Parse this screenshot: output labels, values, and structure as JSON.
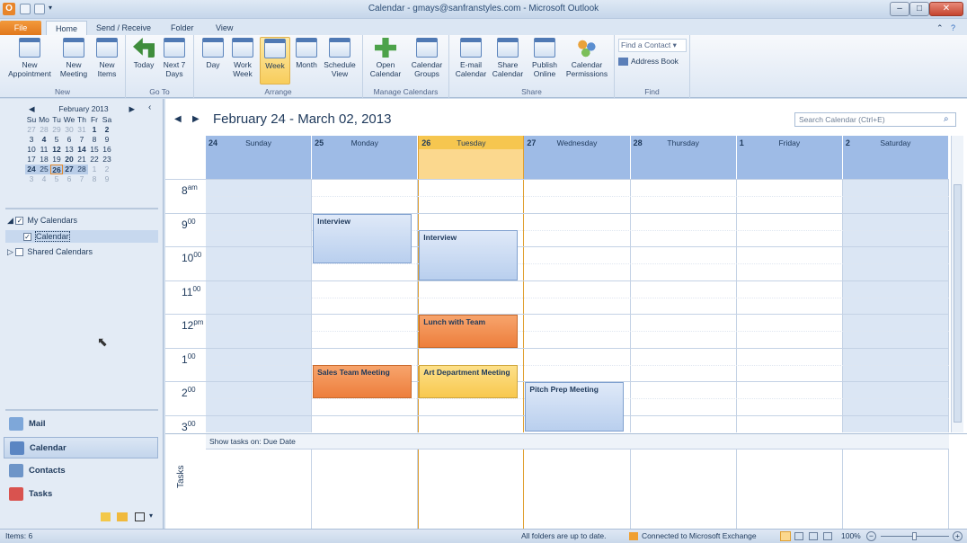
{
  "window": {
    "title": "Calendar - gmays@sanfranstyles.com - Microsoft Outlook",
    "app_letter": "O"
  },
  "tabs": [
    "File",
    "Home",
    "Send / Receive",
    "Folder",
    "View"
  ],
  "ribbon": {
    "groups": [
      "New",
      "Go To",
      "Arrange",
      "Manage Calendars",
      "Share",
      "Find"
    ],
    "buttons": {
      "new_appointment": "New Appointment",
      "new_meeting": "New Meeting",
      "new_items": "New Items",
      "today": "Today",
      "next7": "Next 7 Days",
      "day": "Day",
      "work_week": "Work Week",
      "week": "Week",
      "month": "Month",
      "schedule": "Schedule View",
      "open_calendar": "Open Calendar",
      "calendar_groups": "Calendar Groups",
      "email_calendar": "E-mail Calendar",
      "share_calendar": "Share Calendar",
      "publish_online": "Publish Online",
      "calendar_permissions": "Calendar Permissions",
      "find_contact": "Find a Contact",
      "address_book": "Address Book"
    }
  },
  "minical": {
    "title": "February 2013",
    "weekdays": [
      "Su",
      "Mo",
      "Tu",
      "We",
      "Th",
      "Fr",
      "Sa"
    ],
    "weeks": [
      [
        "27",
        "28",
        "29",
        "30",
        "31",
        "1",
        "2"
      ],
      [
        "3",
        "4",
        "5",
        "6",
        "7",
        "8",
        "9"
      ],
      [
        "10",
        "11",
        "12",
        "13",
        "14",
        "15",
        "16"
      ],
      [
        "17",
        "18",
        "19",
        "20",
        "21",
        "22",
        "23"
      ],
      [
        "24",
        "25",
        "26",
        "27",
        "28",
        "1",
        "2"
      ],
      [
        "3",
        "4",
        "5",
        "6",
        "7",
        "8",
        "9"
      ]
    ]
  },
  "nav": {
    "my_calendars": "My Calendars",
    "calendar": "Calendar",
    "shared_calendars": "Shared Calendars",
    "mail": "Mail",
    "calendar_btn": "Calendar",
    "contacts": "Contacts",
    "tasks": "Tasks"
  },
  "main": {
    "range_title": "February 24 - March 02, 2013",
    "search_placeholder": "Search Calendar (Ctrl+E)",
    "days": [
      {
        "num": "24",
        "name": "Sunday"
      },
      {
        "num": "25",
        "name": "Monday"
      },
      {
        "num": "26",
        "name": "Tuesday"
      },
      {
        "num": "27",
        "name": "Wednesday"
      },
      {
        "num": "28",
        "name": "Thursday"
      },
      {
        "num": "1",
        "name": "Friday"
      },
      {
        "num": "2",
        "name": "Saturday"
      }
    ],
    "times": [
      {
        "h": "8",
        "s": "am"
      },
      {
        "h": "9",
        "s": "00"
      },
      {
        "h": "10",
        "s": "00"
      },
      {
        "h": "11",
        "s": "00"
      },
      {
        "h": "12",
        "s": "pm"
      },
      {
        "h": "1",
        "s": "00"
      },
      {
        "h": "2",
        "s": "00"
      },
      {
        "h": "3",
        "s": "00"
      }
    ],
    "appointments": [
      {
        "title": "Interview",
        "day": 1,
        "start": 9.0,
        "end": 10.5,
        "color": "blue"
      },
      {
        "title": "Interview",
        "day": 2,
        "start": 9.5,
        "end": 11.0,
        "color": "blue"
      },
      {
        "title": "Lunch with Team",
        "day": 2,
        "start": 12.0,
        "end": 13.0,
        "color": "orange"
      },
      {
        "title": "Sales Team Meeting",
        "day": 1,
        "start": 13.5,
        "end": 14.5,
        "color": "orange"
      },
      {
        "title": "Art Department Meeting",
        "day": 2,
        "start": 13.5,
        "end": 14.5,
        "color": "yellow"
      },
      {
        "title": "Pitch Prep Meeting",
        "day": 3,
        "start": 14.0,
        "end": 15.5,
        "color": "blue"
      }
    ],
    "tasks_bar": "Show tasks on: Due Date",
    "tasks_label": "Tasks"
  },
  "status": {
    "items": "Items: 6",
    "sync": "All folders are up to date.",
    "exchange": "Connected to Microsoft Exchange",
    "zoom": "100%"
  }
}
